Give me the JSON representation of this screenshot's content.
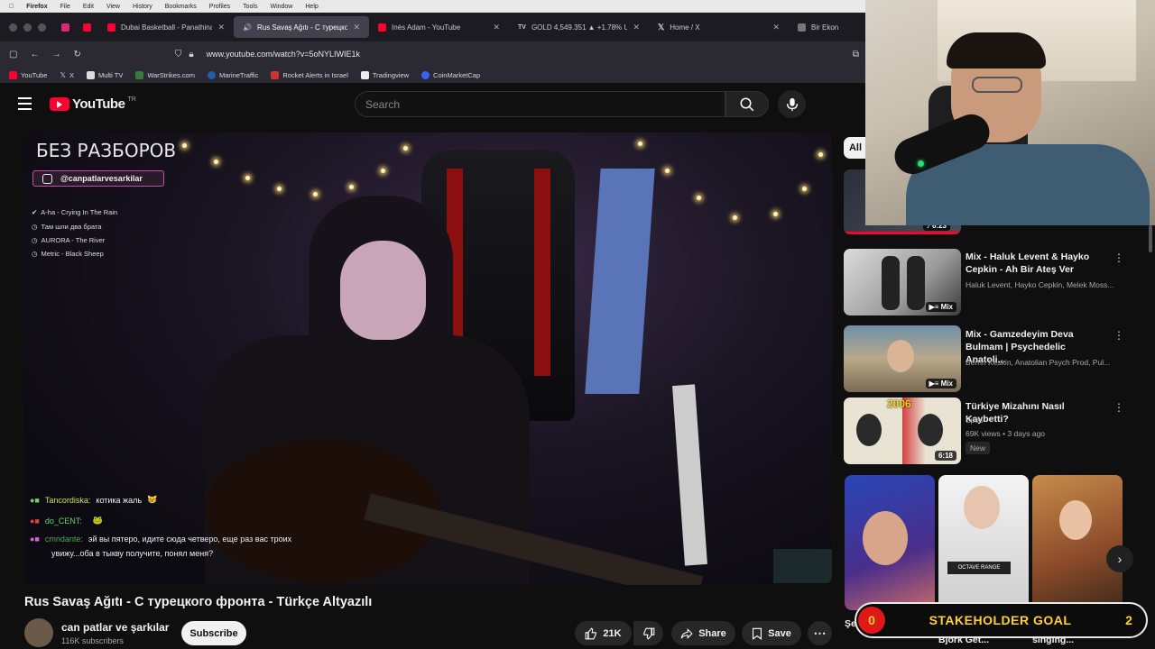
{
  "menubar": {
    "items": [
      "Firefox",
      "File",
      "Edit",
      "View",
      "History",
      "Bookmarks",
      "Profiles",
      "Tools",
      "Window",
      "Help"
    ]
  },
  "tabs": [
    {
      "label": "Dubai Basketball - Panathinaiko",
      "color": "#ff0033"
    },
    {
      "label": "Rus Savaş Ağıtı - С турецко",
      "color": "#ff0033",
      "active": true
    },
    {
      "label": "Inés Adam - YouTube",
      "color": "#ff0033"
    },
    {
      "label": "GOLD 4,549.351 ▲ +1.78% Unn",
      "color": "#222222"
    },
    {
      "label": "Home / X",
      "color": "#000000"
    },
    {
      "label": "Bir Ekon",
      "color": "#5a5a5a"
    }
  ],
  "navbar": {
    "url": "www.youtube.com/watch?v=5oNYLIWIE1k"
  },
  "bookmarks": [
    "YouTube",
    "X",
    "Multi TV",
    "WarStrikes.com",
    "MarineTraffic",
    "Rocket Alerts in Israel",
    "Tradingview",
    "CoinMarketCap"
  ],
  "youtube": {
    "logo": "YouTube",
    "region": "TR",
    "search_placeholder": "Search"
  },
  "video": {
    "overlay_title": "БЕЗ РАЗБОРОВ",
    "overlay_handle": "@canpatlarvesarkilar",
    "songs": [
      "A-ha - Crying In The Rain",
      "Там шли два брата",
      "AURORA - The River",
      "Metric - Black Sheep"
    ],
    "chat": [
      {
        "user": "Tancordiska:",
        "msg": "котика жаль"
      },
      {
        "user": "do_CENT:",
        "msg": ""
      },
      {
        "user": "cmndante:",
        "msg": "эй вы пятеро, идите сюда четверо, еще раз вас троих"
      },
      {
        "user": "",
        "msg": "увижу...оба в тыкву получите, понял меня?"
      }
    ]
  },
  "meta": {
    "title": "Rus Savaş Ağıtı - С турецкого фронта - Türkçe Altyazılı",
    "channel": "can patlar ve şarkılar",
    "subscribers": "116K subscribers",
    "subscribe": "Subscribe",
    "likes": "21K",
    "share": "Share",
    "save": "Save"
  },
  "sidebar": {
    "chip_all": "All",
    "first_duration": "6:23",
    "items": [
      {
        "title": "Mix - Haluk Levent & Hayko Cepkin - Ah Bir Ateş Ver",
        "meta": "Haluk Levent, Hayko Cepkin, Melek Moss...",
        "badge": "Mix"
      },
      {
        "title": "Mix - Gamzedeyim Deva Bulmam | Psychedelic Anatoli...",
        "meta": "Berrin Keskin, Anatolian Psych Prod, Pul...",
        "badge": "Mix"
      },
      {
        "title": "Türkiye Mizahını Nasıl Kaybetti?",
        "meta": "Spes",
        "meta2": "69K views • 3 days ago",
        "tag": "New",
        "badge": "6:18",
        "thumb_year": "2006"
      }
    ],
    "shorts": [
      {
        "title": "Şe... Feran ve..."
      },
      {
        "title": "Bjork Get...",
        "caption": "OCTAVE RANGE"
      },
      {
        "title": "singing..."
      }
    ]
  },
  "stream_overlay": {
    "goal_current": "0",
    "goal_label": "STAKEHOLDER GOAL",
    "goal_target": "2"
  }
}
